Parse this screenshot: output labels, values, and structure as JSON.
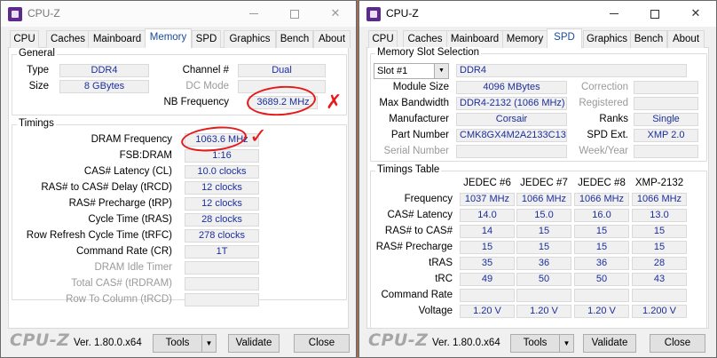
{
  "left_window": {
    "title": "CPU-Z",
    "tabs": [
      "CPU",
      "Caches",
      "Mainboard",
      "Memory",
      "SPD",
      "Graphics",
      "Bench",
      "About"
    ],
    "active_tab": "Memory",
    "general": {
      "title": "General",
      "type_label": "Type",
      "type_value": "DDR4",
      "size_label": "Size",
      "size_value": "8 GBytes",
      "channel_label": "Channel #",
      "channel_value": "Dual",
      "dc_mode_label": "DC Mode",
      "dc_mode_value": "",
      "nb_freq_label": "NB Frequency",
      "nb_freq_value": "3689.2 MHz"
    },
    "timings": {
      "title": "Timings",
      "rows": [
        {
          "label": "DRAM Frequency",
          "value": "1063.6 MHz",
          "disabled": false
        },
        {
          "label": "FSB:DRAM",
          "value": "1:16",
          "disabled": false
        },
        {
          "label": "CAS# Latency (CL)",
          "value": "10.0 clocks",
          "disabled": false
        },
        {
          "label": "RAS# to CAS# Delay (tRCD)",
          "value": "12 clocks",
          "disabled": false
        },
        {
          "label": "RAS# Precharge (tRP)",
          "value": "12 clocks",
          "disabled": false
        },
        {
          "label": "Cycle Time (tRAS)",
          "value": "28 clocks",
          "disabled": false
        },
        {
          "label": "Row Refresh Cycle Time (tRFC)",
          "value": "278 clocks",
          "disabled": false
        },
        {
          "label": "Command Rate (CR)",
          "value": "1T",
          "disabled": false
        },
        {
          "label": "DRAM Idle Timer",
          "value": "",
          "disabled": true
        },
        {
          "label": "Total CAS# (tRDRAM)",
          "value": "",
          "disabled": true
        },
        {
          "label": "Row To Column (tRCD)",
          "value": "",
          "disabled": true
        }
      ]
    },
    "footer": {
      "brand": "CPU-Z",
      "version": "Ver. 1.80.0.x64",
      "tools": "Tools",
      "validate": "Validate",
      "close": "Close"
    }
  },
  "right_window": {
    "title": "CPU-Z",
    "tabs": [
      "CPU",
      "Caches",
      "Mainboard",
      "Memory",
      "SPD",
      "Graphics",
      "Bench",
      "About"
    ],
    "active_tab": "SPD",
    "slot": {
      "title": "Memory Slot Selection",
      "selected": "Slot #1",
      "type_value": "DDR4",
      "module_size_label": "Module Size",
      "module_size_value": "4096 MBytes",
      "max_bw_label": "Max Bandwidth",
      "max_bw_value": "DDR4-2132 (1066 MHz)",
      "manufacturer_label": "Manufacturer",
      "manufacturer_value": "Corsair",
      "part_label": "Part Number",
      "part_value": "CMK8GX4M2A2133C13",
      "serial_label": "Serial Number",
      "serial_value": "",
      "correction_label": "Correction",
      "correction_value": "",
      "registered_label": "Registered",
      "registered_value": "",
      "ranks_label": "Ranks",
      "ranks_value": "Single",
      "spd_ext_label": "SPD Ext.",
      "spd_ext_value": "XMP 2.0",
      "week_year_label": "Week/Year",
      "week_year_value": ""
    },
    "timings_table": {
      "title": "Timings Table",
      "columns": [
        "JEDEC #6",
        "JEDEC #7",
        "JEDEC #8",
        "XMP-2132"
      ],
      "rows": [
        {
          "label": "Frequency",
          "values": [
            "1037 MHz",
            "1066 MHz",
            "1066 MHz",
            "1066 MHz"
          ]
        },
        {
          "label": "CAS# Latency",
          "values": [
            "14.0",
            "15.0",
            "16.0",
            "13.0"
          ]
        },
        {
          "label": "RAS# to CAS#",
          "values": [
            "14",
            "15",
            "15",
            "15"
          ]
        },
        {
          "label": "RAS# Precharge",
          "values": [
            "15",
            "15",
            "15",
            "15"
          ]
        },
        {
          "label": "tRAS",
          "values": [
            "35",
            "36",
            "36",
            "28"
          ]
        },
        {
          "label": "tRC",
          "values": [
            "49",
            "50",
            "50",
            "43"
          ]
        },
        {
          "label": "Command Rate",
          "values": [
            "",
            "",
            "",
            ""
          ]
        },
        {
          "label": "Voltage",
          "values": [
            "1.20 V",
            "1.20 V",
            "1.20 V",
            "1.200 V"
          ]
        }
      ]
    },
    "footer": {
      "brand": "CPU-Z",
      "version": "Ver. 1.80.0.x64",
      "tools": "Tools",
      "validate": "Validate",
      "close": "Close"
    }
  },
  "colors": {
    "value_text": "#1b2e9c",
    "annotation": "#e51a1a",
    "active_tab_text": "#1a4aa0"
  }
}
